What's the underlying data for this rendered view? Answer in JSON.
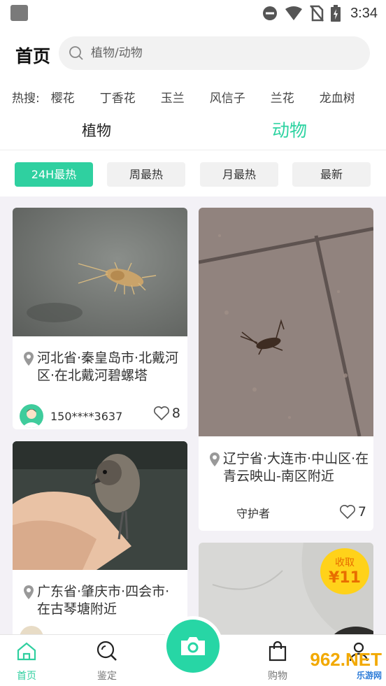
{
  "status_bar": {
    "time": "3:34"
  },
  "header": {
    "title": "首页",
    "search_placeholder": "植物/动物"
  },
  "hot_search": {
    "label": "热搜:",
    "items": [
      "樱花",
      "丁香花",
      "玉兰",
      "风信子",
      "兰花",
      "龙血树"
    ]
  },
  "category_tabs": [
    {
      "label": "植物",
      "active": false
    },
    {
      "label": "动物",
      "active": true
    }
  ],
  "filters": [
    {
      "label": "24H最热",
      "active": true
    },
    {
      "label": "周最热",
      "active": false
    },
    {
      "label": "月最热",
      "active": false
    },
    {
      "label": "最新",
      "active": false
    }
  ],
  "cards": [
    {
      "location": "河北省·秦皇岛市·北戴河区·在北戴河碧螺塔",
      "user": "150****3637",
      "likes": "8"
    },
    {
      "location": "辽宁省·大连市·中山区·在青云映山-南区附近",
      "user": "守护者",
      "likes": "7"
    },
    {
      "location": "广东省·肇庆市·四会市·在古琴塘附近"
    },
    {
      "reward_label": "收取",
      "reward_price": "¥11"
    }
  ],
  "bottom_nav": [
    {
      "label": "首页",
      "icon": "home-icon",
      "active": true
    },
    {
      "label": "鉴定",
      "icon": "identify-icon",
      "active": false
    },
    {
      "label": "购物",
      "icon": "shopping-bag-icon",
      "active": false
    },
    {
      "label": "",
      "icon": "profile-icon",
      "active": false
    }
  ],
  "watermark": {
    "brand": "962.NET",
    "sub": "乐游网"
  },
  "colors": {
    "accent": "#2fd0a0",
    "reward": "#ffd21a"
  }
}
